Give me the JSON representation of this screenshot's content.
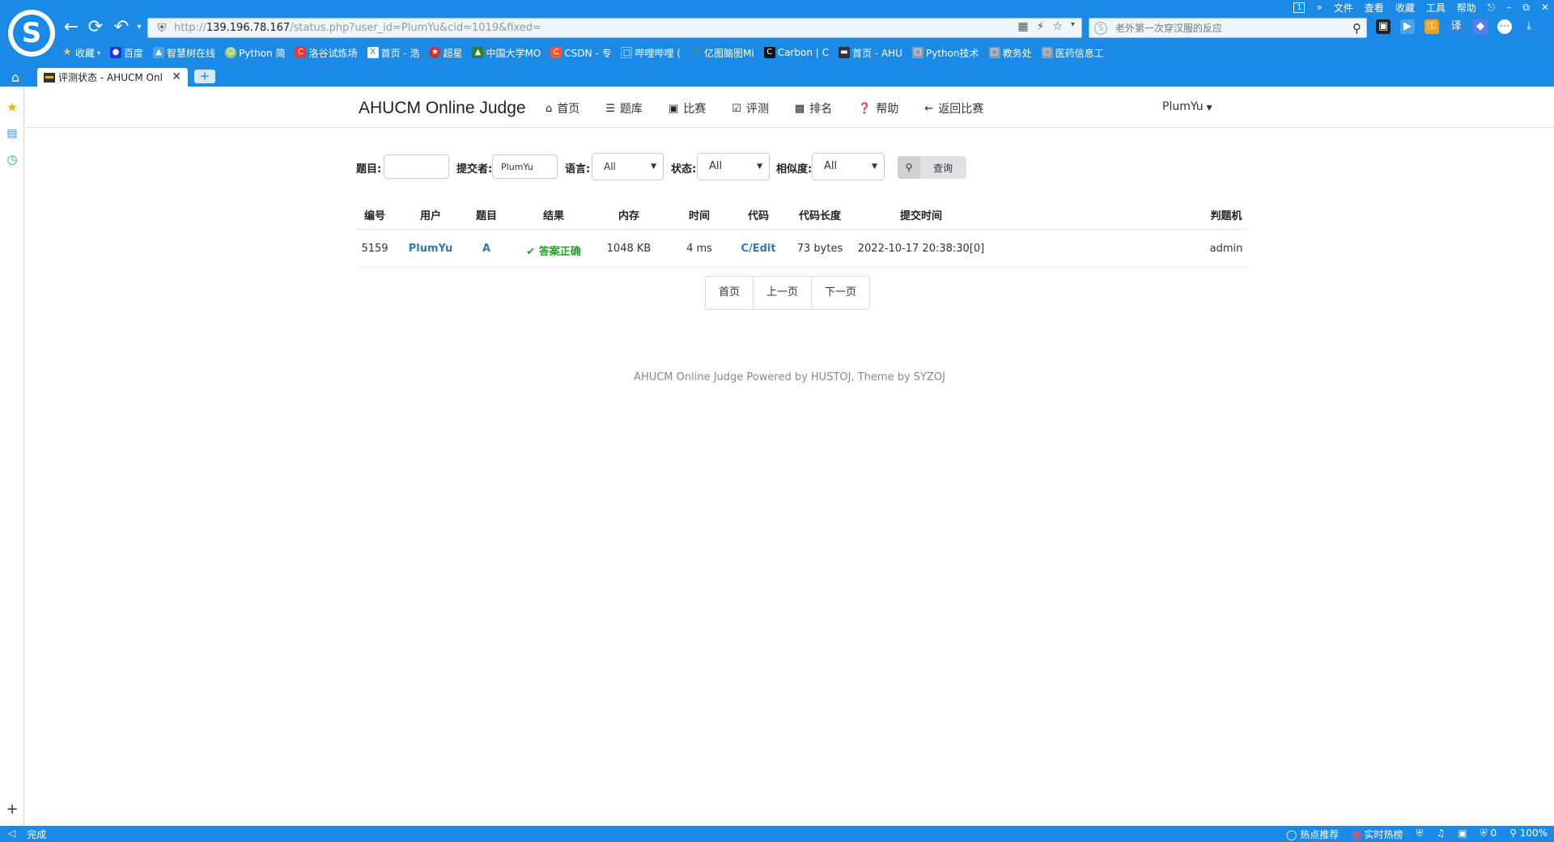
{
  "browser": {
    "url_prefix": "http://",
    "url_host": "139.196.78.167",
    "url_path": "/status.php?user_id=PlumYu&cid=1019&fixed=",
    "search_placeholder": "老外第一次穿汉服的反应",
    "menu": [
      "文件",
      "查看",
      "收藏",
      "工具",
      "帮助"
    ],
    "tab_badge": "1",
    "bookmarks": [
      "收藏",
      "百度",
      "智慧树在线",
      "Python 简",
      "洛谷试炼场",
      "首页 - 浩",
      "超星",
      "中国大学MO",
      "CSDN - 专",
      "哔哩哔哩 (",
      "亿图脑图Mi",
      "Carbon | C",
      "首页 - AHU",
      "Python技术",
      "教务处",
      "医药信息工"
    ],
    "tab_title": "评测状态 - AHUCM Onl",
    "status_left": "完成",
    "status_right": [
      "热点推荐",
      "实时热榜",
      "0",
      "100%"
    ]
  },
  "site": {
    "brand": "AHUCM Online Judge",
    "nav": [
      "首页",
      "题库",
      "比赛",
      "评测",
      "排名",
      "帮助",
      "返回比赛"
    ],
    "user": "PlumYu"
  },
  "filter": {
    "problem_label": "题目:",
    "problem_value": "",
    "submitter_label": "提交者:",
    "submitter_value": "PlumYu",
    "language_label": "语言:",
    "language_value": "All",
    "status_label": "状态:",
    "status_value": "All",
    "similarity_label": "相似度:",
    "similarity_value": "All",
    "search_button": "查询"
  },
  "table": {
    "headers": [
      "编号",
      "用户",
      "题目",
      "结果",
      "内存",
      "时间",
      "代码",
      "代码长度",
      "提交时间",
      "判题机"
    ],
    "rows": [
      {
        "id": "5159",
        "user": "PlumYu",
        "problem": "A",
        "result": "答案正确",
        "memory": "1048 KB",
        "time": "4 ms",
        "code": "C/Edit",
        "length": "73 bytes",
        "submit_time": "2022-10-17 20:38:30[0]",
        "judger": "admin"
      }
    ]
  },
  "pager": [
    "首页",
    "上一页",
    "下一页"
  ],
  "footer": "AHUCM Online Judge Powered by HUSTOJ, Theme by SYZOJ",
  "colors": {
    "chrome": "#1a8ae6",
    "link": "#337ab7",
    "accepted": "#2c9a2c"
  }
}
